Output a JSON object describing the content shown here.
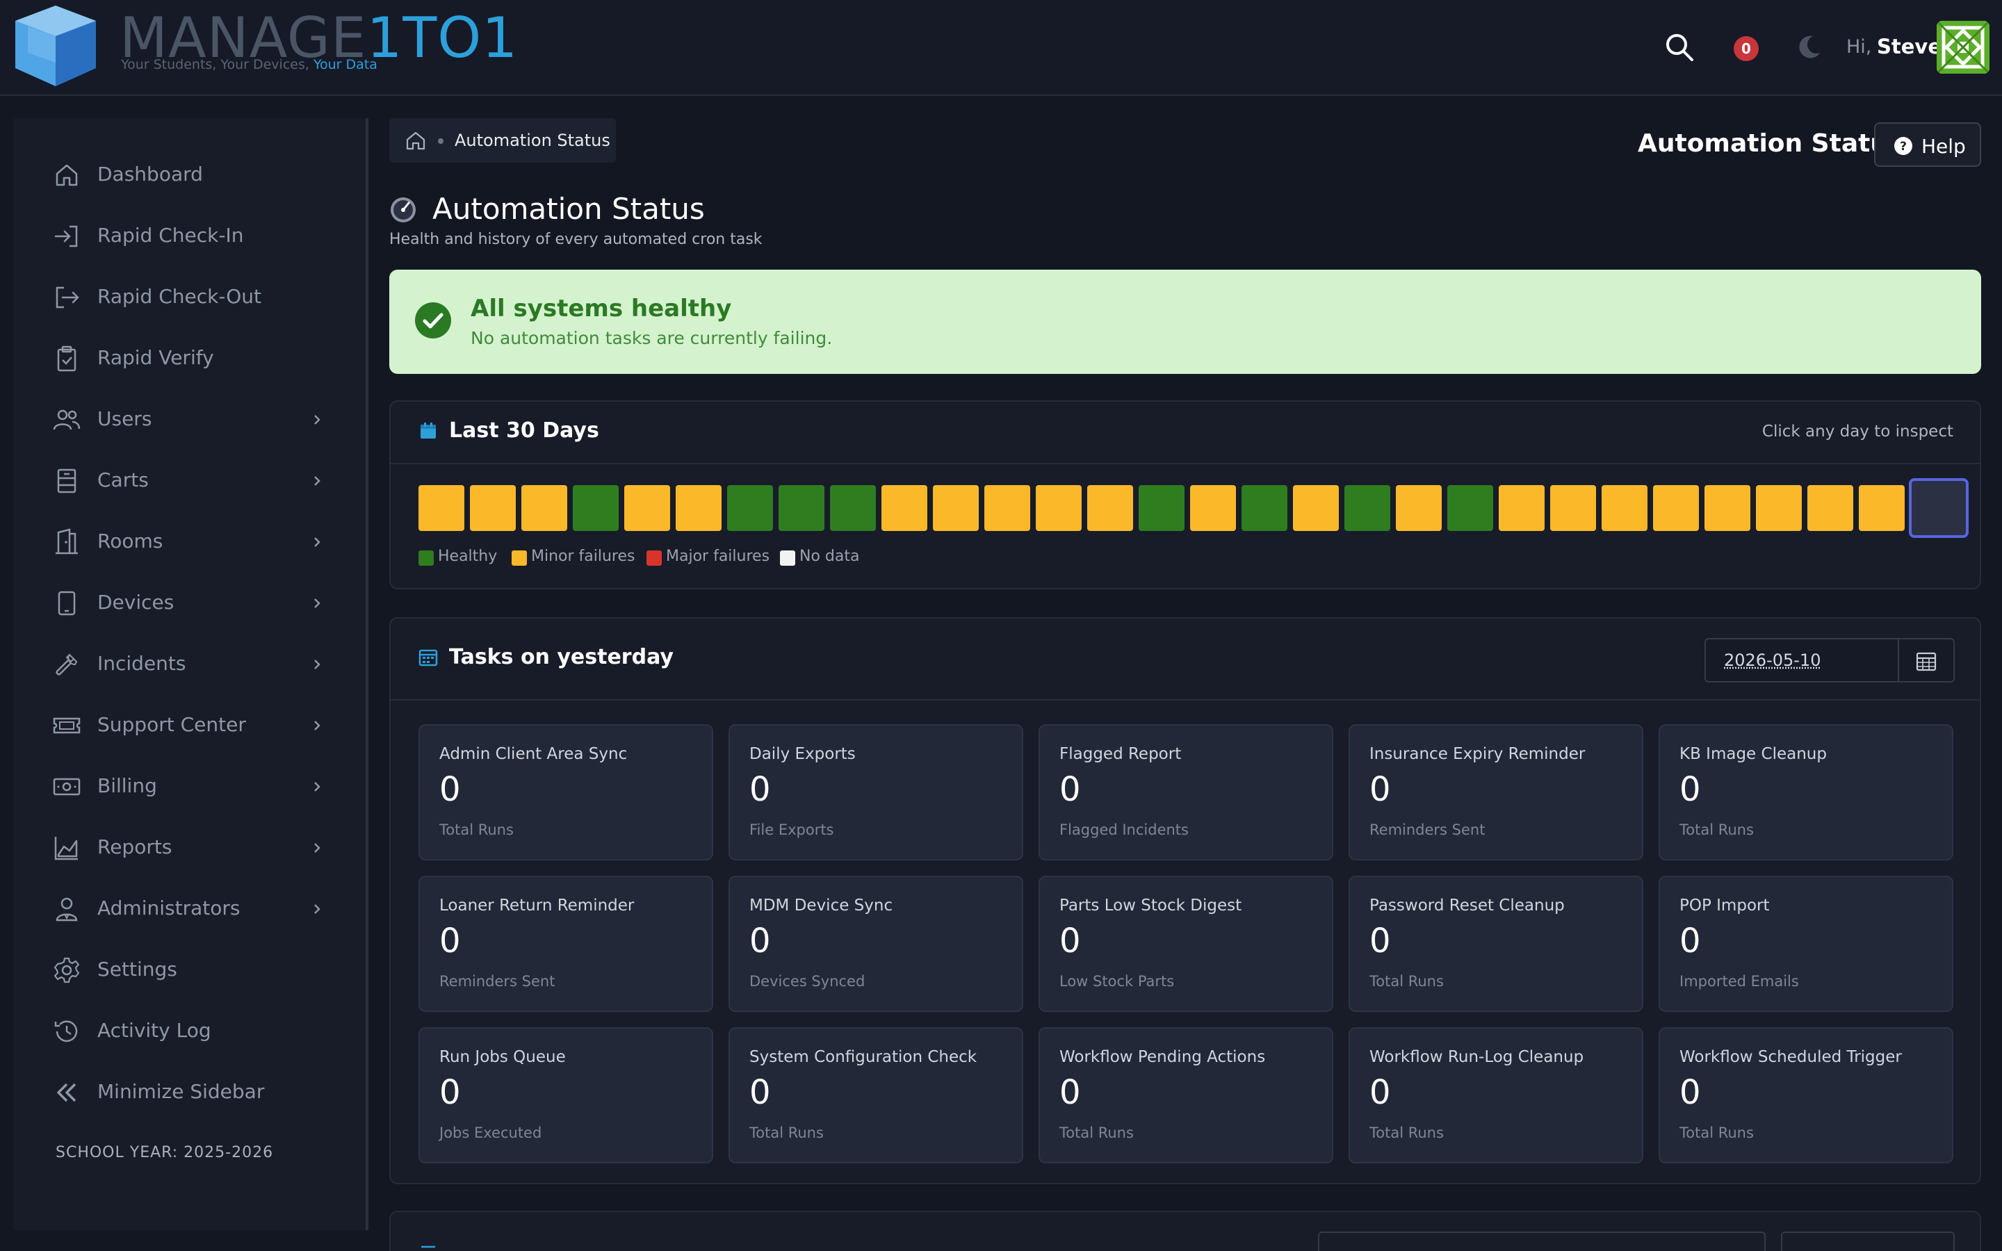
{
  "app": {
    "logo_main": "MANAGE",
    "logo_accent": "1TO1",
    "logo_tagline": "Your Students, Your Devices, ",
    "logo_tagline_accent": "Your Data"
  },
  "topbar": {
    "notifications_count": "0",
    "greeting": "Hi,",
    "user_name": "Steve"
  },
  "sidebar": {
    "items": [
      {
        "label": "Dashboard",
        "icon": "home-icon",
        "has_children": false
      },
      {
        "label": "Rapid Check-In",
        "icon": "login-icon",
        "has_children": false
      },
      {
        "label": "Rapid Check-Out",
        "icon": "logout-icon",
        "has_children": false
      },
      {
        "label": "Rapid Verify",
        "icon": "clipboard-check-icon",
        "has_children": false
      },
      {
        "label": "Users",
        "icon": "users-icon",
        "has_children": true
      },
      {
        "label": "Carts",
        "icon": "cart-icon",
        "has_children": true
      },
      {
        "label": "Rooms",
        "icon": "door-icon",
        "has_children": true
      },
      {
        "label": "Devices",
        "icon": "tablet-icon",
        "has_children": true
      },
      {
        "label": "Incidents",
        "icon": "wrench-icon",
        "has_children": true
      },
      {
        "label": "Support Center",
        "icon": "ticket-icon",
        "has_children": true
      },
      {
        "label": "Billing",
        "icon": "cash-icon",
        "has_children": true
      },
      {
        "label": "Reports",
        "icon": "chart-area-icon",
        "has_children": true
      },
      {
        "label": "Administrators",
        "icon": "admin-user-icon",
        "has_children": true
      },
      {
        "label": "Settings",
        "icon": "gear-icon",
        "has_children": false
      },
      {
        "label": "Activity Log",
        "icon": "history-icon",
        "has_children": false
      },
      {
        "label": "Minimize Sidebar",
        "icon": "double-chevron-left-icon",
        "has_children": false
      }
    ],
    "school_year": "SCHOOL YEAR: 2025-2026"
  },
  "breadcrumb": {
    "current": "Automation Status"
  },
  "header": {
    "title": "Automation Status",
    "help_label": "Help"
  },
  "page": {
    "title": "Automation Status",
    "subtitle": "Health and history of every automated cron task"
  },
  "status_banner": {
    "title": "All systems healthy",
    "message": "No automation tasks are currently failing.",
    "color": "#d5f2cf"
  },
  "last30": {
    "title": "Last 30 Days",
    "hint": "Click any day to inspect",
    "days": [
      "minor",
      "minor",
      "minor",
      "healthy",
      "minor",
      "minor",
      "healthy",
      "healthy",
      "healthy",
      "minor",
      "minor",
      "minor",
      "minor",
      "minor",
      "healthy",
      "minor",
      "healthy",
      "minor",
      "healthy",
      "minor",
      "healthy",
      "minor",
      "minor",
      "minor",
      "minor",
      "minor",
      "minor",
      "minor",
      "minor",
      "nodata-selected"
    ],
    "legend": [
      {
        "label": "Healthy",
        "color": "#2e7d1f"
      },
      {
        "label": "Minor failures",
        "color": "#fbb829"
      },
      {
        "label": "Major failures",
        "color": "#d9342c"
      },
      {
        "label": "No data",
        "color": "#f2f2f2"
      }
    ]
  },
  "tasks": {
    "title": "Tasks on yesterday",
    "date": "2026-05-10",
    "cards": [
      {
        "title": "Admin Client Area Sync",
        "value": "0",
        "sub": "Total Runs"
      },
      {
        "title": "Daily Exports",
        "value": "0",
        "sub": "File Exports"
      },
      {
        "title": "Flagged Report",
        "value": "0",
        "sub": "Flagged Incidents"
      },
      {
        "title": "Insurance Expiry Reminder",
        "value": "0",
        "sub": "Reminders Sent"
      },
      {
        "title": "KB Image Cleanup",
        "value": "0",
        "sub": "Total Runs"
      },
      {
        "title": "Loaner Return Reminder",
        "value": "0",
        "sub": "Reminders Sent"
      },
      {
        "title": "MDM Device Sync",
        "value": "0",
        "sub": "Devices Synced"
      },
      {
        "title": "Parts Low Stock Digest",
        "value": "0",
        "sub": "Low Stock Parts"
      },
      {
        "title": "Password Reset Cleanup",
        "value": "0",
        "sub": "Total Runs"
      },
      {
        "title": "POP Import",
        "value": "0",
        "sub": "Imported Emails"
      },
      {
        "title": "Run Jobs Queue",
        "value": "0",
        "sub": "Jobs Executed"
      },
      {
        "title": "System Configuration Check",
        "value": "0",
        "sub": "Total Runs"
      },
      {
        "title": "Workflow Pending Actions",
        "value": "0",
        "sub": "Total Runs"
      },
      {
        "title": "Workflow Run-Log Cleanup",
        "value": "0",
        "sub": "Total Runs"
      },
      {
        "title": "Workflow Scheduled Trigger",
        "value": "0",
        "sub": "Total Runs"
      }
    ]
  },
  "colors": {
    "healthy": "#2e7d1f",
    "minor": "#fbb829",
    "major": "#d9342c",
    "accent": "#2da0dc"
  }
}
